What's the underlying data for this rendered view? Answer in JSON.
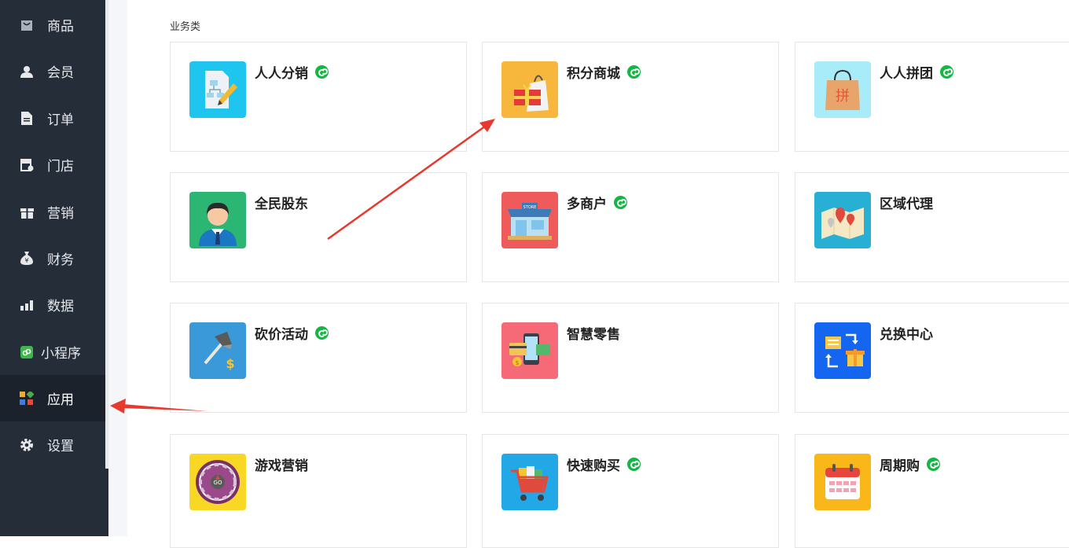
{
  "sidebar": {
    "items": [
      {
        "label": "商品",
        "icon": "bag-icon"
      },
      {
        "label": "会员",
        "icon": "user-icon"
      },
      {
        "label": "订单",
        "icon": "document-icon"
      },
      {
        "label": "门店",
        "icon": "store-icon"
      },
      {
        "label": "营销",
        "icon": "gift-icon"
      },
      {
        "label": "财务",
        "icon": "money-bag-icon"
      },
      {
        "label": "数据",
        "icon": "bar-chart-icon"
      },
      {
        "label": "小程序",
        "icon": "mini-program-icon"
      },
      {
        "label": "应用",
        "icon": "apps-icon",
        "active": true
      },
      {
        "label": "设置",
        "icon": "gear-icon"
      }
    ]
  },
  "section": {
    "title": "业务类"
  },
  "apps": [
    {
      "title": "人人分销",
      "icon": "distribution-icon",
      "mini_program": true
    },
    {
      "title": "积分商城",
      "icon": "shopping-bag-gift-icon",
      "mini_program": true
    },
    {
      "title": "人人拼团",
      "icon": "group-buy-bag-icon",
      "mini_program": true
    },
    {
      "title": "全民股东",
      "icon": "businessman-icon",
      "mini_program": false
    },
    {
      "title": "多商户",
      "icon": "storefront-icon",
      "mini_program": true
    },
    {
      "title": "区域代理",
      "icon": "map-pin-icon",
      "mini_program": false
    },
    {
      "title": "砍价活动",
      "icon": "axe-icon",
      "mini_program": true
    },
    {
      "title": "智慧零售",
      "icon": "mobile-pay-icon",
      "mini_program": false
    },
    {
      "title": "兑换中心",
      "icon": "exchange-icon",
      "mini_program": false
    },
    {
      "title": "游戏营销",
      "icon": "prize-wheel-icon",
      "mini_program": false
    },
    {
      "title": "快速购买",
      "icon": "shopping-cart-icon",
      "mini_program": true
    },
    {
      "title": "周期购",
      "icon": "calendar-icon",
      "mini_program": true
    }
  ],
  "colors": {
    "sidebar_bg": "#252d38",
    "active_bg": "#1c222b",
    "mini_badge": "#13b743",
    "annotation_arrow": "#e8392f"
  }
}
